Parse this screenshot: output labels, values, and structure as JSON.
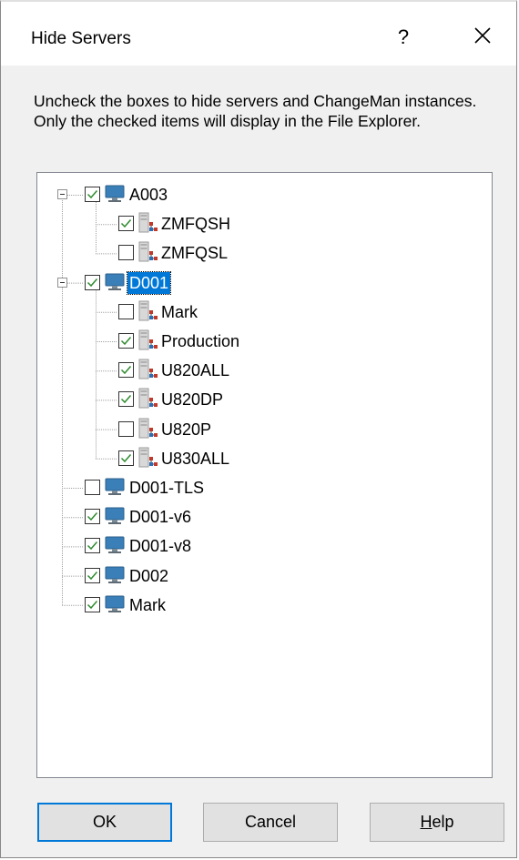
{
  "dialog": {
    "title": "Hide Servers",
    "help_glyph": "?",
    "close_icon": "close-icon",
    "description": "Uncheck the boxes to hide servers and ChangeMan instances.  Only the checked items will display in the File Explorer."
  },
  "tree": {
    "nodes": [
      {
        "label": "A003",
        "checked": true,
        "kind": "server",
        "level": 0,
        "expanded": true
      },
      {
        "label": "ZMFQSH",
        "checked": true,
        "kind": "instance",
        "level": 1
      },
      {
        "label": "ZMFQSL",
        "checked": false,
        "kind": "instance",
        "level": 1
      },
      {
        "label": "D001",
        "checked": true,
        "kind": "server",
        "level": 0,
        "expanded": true,
        "selected": true
      },
      {
        "label": "Mark",
        "checked": false,
        "kind": "instance",
        "level": 1
      },
      {
        "label": "Production",
        "checked": true,
        "kind": "instance",
        "level": 1
      },
      {
        "label": "U820ALL",
        "checked": true,
        "kind": "instance",
        "level": 1
      },
      {
        "label": "U820DP",
        "checked": true,
        "kind": "instance",
        "level": 1
      },
      {
        "label": "U820P",
        "checked": false,
        "kind": "instance",
        "level": 1
      },
      {
        "label": "U830ALL",
        "checked": true,
        "kind": "instance",
        "level": 1
      },
      {
        "label": "D001-TLS",
        "checked": false,
        "kind": "server",
        "level": 0
      },
      {
        "label": "D001-v6",
        "checked": true,
        "kind": "server",
        "level": 0
      },
      {
        "label": "D001-v8",
        "checked": true,
        "kind": "server",
        "level": 0
      },
      {
        "label": "D002",
        "checked": true,
        "kind": "server",
        "level": 0
      },
      {
        "label": "Mark",
        "checked": true,
        "kind": "server",
        "level": 0
      }
    ]
  },
  "buttons": {
    "ok": "OK",
    "cancel": "Cancel",
    "help_first": "H",
    "help_rest": "elp"
  },
  "colors": {
    "check": "#2e8b2e",
    "selection": "#0078d7",
    "monitor": "#3a7fb8"
  }
}
